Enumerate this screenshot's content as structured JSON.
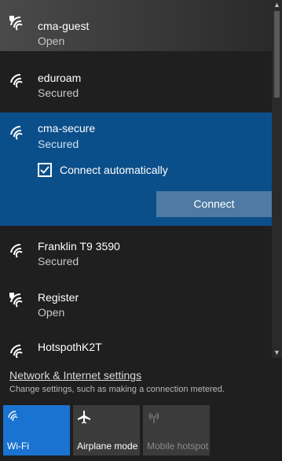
{
  "networks": [
    {
      "name": "cma-guest",
      "status": "Open",
      "icon": "wifi-shield-icon"
    },
    {
      "name": "eduroam",
      "status": "Secured",
      "icon": "wifi-icon"
    },
    {
      "name": "cma-secure",
      "status": "Secured",
      "icon": "wifi-icon",
      "auto_label": "Connect automatically",
      "connect_label": "Connect"
    },
    {
      "name": "Franklin T9 3590",
      "status": "Secured",
      "icon": "wifi-icon"
    },
    {
      "name": "Register",
      "status": "Open",
      "icon": "wifi-shield-icon"
    },
    {
      "name": "HotspothK2T",
      "status": "",
      "icon": "wifi-icon"
    }
  ],
  "settings": {
    "link": "Network & Internet settings",
    "description": "Change settings, such as making a connection metered."
  },
  "quick_actions": {
    "wifi": "Wi-Fi",
    "airplane": "Airplane mode",
    "hotspot": "Mobile hotspot"
  },
  "colors": {
    "selected_bg": "#0b4f8a",
    "connect_button": "#4e7aa3",
    "wifi_tile": "#1a73d0"
  }
}
